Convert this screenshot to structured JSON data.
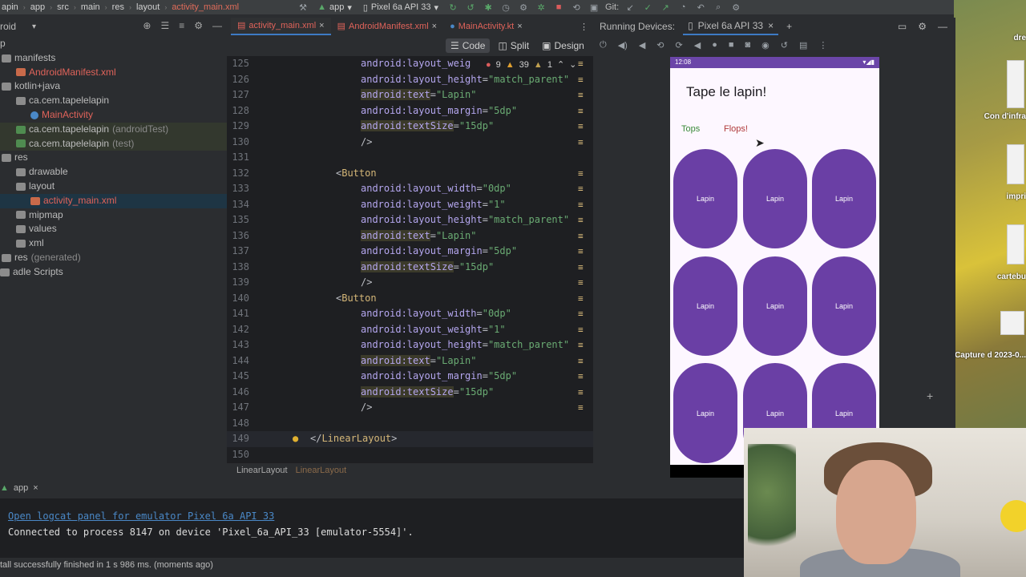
{
  "topbar": {
    "crumbs": [
      "apin",
      "app",
      "src",
      "main",
      "res",
      "layout"
    ],
    "file": "activity_main.xml",
    "run_config": "app",
    "device": "Pixel 6a API 33",
    "git_label": "Git:"
  },
  "project": {
    "header": "roid",
    "tree": [
      {
        "label": "p",
        "style": "plain"
      },
      {
        "label": "manifests",
        "style": "plain"
      },
      {
        "label": "AndroidManifest.xml",
        "style": "red"
      },
      {
        "label": "kotlin+java",
        "style": "plain"
      },
      {
        "label": "ca.cem.tapelelapin",
        "style": "plain"
      },
      {
        "label": "MainActivity",
        "style": "kt"
      },
      {
        "label": "ca.cem.tapelelapin",
        "suffix": "(androidTest)",
        "style": "test"
      },
      {
        "label": "ca.cem.tapelelapin",
        "suffix": "(test)",
        "style": "test"
      },
      {
        "label": "res",
        "style": "plain"
      },
      {
        "label": "drawable",
        "style": "plain"
      },
      {
        "label": "layout",
        "style": "plain"
      },
      {
        "label": "activity_main.xml",
        "style": "selected"
      },
      {
        "label": "mipmap",
        "style": "plain"
      },
      {
        "label": "values",
        "style": "plain"
      },
      {
        "label": "xml",
        "style": "plain"
      },
      {
        "label": "res",
        "suffix": "(generated)",
        "style": "plain"
      },
      {
        "label": "adle Scripts",
        "style": "plain"
      }
    ]
  },
  "editor": {
    "tabs": [
      "activity_main.xml",
      "AndroidManifest.xml",
      "MainActivity.kt"
    ],
    "view_modes": [
      "Code",
      "Split",
      "Design"
    ],
    "errors": "9",
    "warnings": "39",
    "weak_warnings": "1",
    "lines": [
      {
        "n": "125",
        "parts": [
          [
            "attr",
            "android:layout_weig"
          ]
        ]
      },
      {
        "n": "126",
        "parts": [
          [
            "attr",
            "android:layout_height"
          ],
          [
            "brk",
            "="
          ],
          [
            "str",
            "\"match_parent\""
          ]
        ]
      },
      {
        "n": "127",
        "parts": [
          [
            "attr-dim",
            "android:text"
          ],
          [
            "brk",
            "="
          ],
          [
            "str",
            "\"Lapin\""
          ]
        ]
      },
      {
        "n": "128",
        "parts": [
          [
            "attr",
            "android:layout_margin"
          ],
          [
            "brk",
            "="
          ],
          [
            "str",
            "\"5dp\""
          ]
        ]
      },
      {
        "n": "129",
        "parts": [
          [
            "attr-dim",
            "android:textSize"
          ],
          [
            "brk",
            "="
          ],
          [
            "str",
            "\"15dp\""
          ]
        ]
      },
      {
        "n": "130",
        "parts": [
          [
            "brk",
            "/>"
          ]
        ]
      },
      {
        "n": "131",
        "parts": []
      },
      {
        "n": "132",
        "parts": [
          [
            "brk",
            "<"
          ],
          [
            "tag",
            "Button"
          ]
        ],
        "indent": "tag"
      },
      {
        "n": "133",
        "parts": [
          [
            "attr",
            "android:layout_width"
          ],
          [
            "brk",
            "="
          ],
          [
            "str",
            "\"0dp\""
          ]
        ]
      },
      {
        "n": "134",
        "parts": [
          [
            "attr",
            "android:layout_weight"
          ],
          [
            "brk",
            "="
          ],
          [
            "str",
            "\"1\""
          ]
        ]
      },
      {
        "n": "135",
        "parts": [
          [
            "attr",
            "android:layout_height"
          ],
          [
            "brk",
            "="
          ],
          [
            "str",
            "\"match_parent\""
          ]
        ]
      },
      {
        "n": "136",
        "parts": [
          [
            "attr-dim",
            "android:text"
          ],
          [
            "brk",
            "="
          ],
          [
            "str",
            "\"Lapin\""
          ]
        ]
      },
      {
        "n": "137",
        "parts": [
          [
            "attr",
            "android:layout_margin"
          ],
          [
            "brk",
            "="
          ],
          [
            "str",
            "\"5dp\""
          ]
        ]
      },
      {
        "n": "138",
        "parts": [
          [
            "attr-dim",
            "android:textSize"
          ],
          [
            "brk",
            "="
          ],
          [
            "str",
            "\"15dp\""
          ]
        ]
      },
      {
        "n": "139",
        "parts": [
          [
            "brk",
            "/>"
          ]
        ]
      },
      {
        "n": "140",
        "parts": [
          [
            "brk",
            "<"
          ],
          [
            "tag",
            "Button"
          ]
        ],
        "indent": "tag"
      },
      {
        "n": "141",
        "parts": [
          [
            "attr",
            "android:layout_width"
          ],
          [
            "brk",
            "="
          ],
          [
            "str",
            "\"0dp\""
          ]
        ]
      },
      {
        "n": "142",
        "parts": [
          [
            "attr",
            "android:layout_weight"
          ],
          [
            "brk",
            "="
          ],
          [
            "str",
            "\"1\""
          ]
        ]
      },
      {
        "n": "143",
        "parts": [
          [
            "attr",
            "android:layout_height"
          ],
          [
            "brk",
            "="
          ],
          [
            "str",
            "\"match_parent\""
          ]
        ]
      },
      {
        "n": "144",
        "parts": [
          [
            "attr-dim",
            "android:text"
          ],
          [
            "brk",
            "="
          ],
          [
            "str",
            "\"Lapin\""
          ]
        ]
      },
      {
        "n": "145",
        "parts": [
          [
            "attr",
            "android:layout_margin"
          ],
          [
            "brk",
            "="
          ],
          [
            "str",
            "\"5dp\""
          ]
        ]
      },
      {
        "n": "146",
        "parts": [
          [
            "attr-dim",
            "android:textSize"
          ],
          [
            "brk",
            "="
          ],
          [
            "str",
            "\"15dp\""
          ]
        ]
      },
      {
        "n": "147",
        "parts": [
          [
            "brk",
            "/>"
          ]
        ]
      },
      {
        "n": "148",
        "parts": []
      },
      {
        "n": "149",
        "parts": [
          [
            "brk",
            "</"
          ],
          [
            "tag",
            "LinearLayout"
          ],
          [
            "brk",
            ">"
          ]
        ],
        "indent": "root"
      },
      {
        "n": "150",
        "parts": []
      }
    ],
    "bottom_breadcrumb": [
      "LinearLayout",
      "LinearLayout"
    ]
  },
  "running_devices": {
    "title": "Running Devices:",
    "device_tab": "Pixel 6a API 33"
  },
  "phone": {
    "time": "12:08",
    "app_title": "Tape le lapin!",
    "tops": "Tops",
    "flops": "Flops!",
    "button_label": "Lapin",
    "button_count": 9,
    "colors": {
      "button": "#6a3fa5",
      "status": "#6b46a8",
      "tops": "#3a8a3a",
      "flops": "#b03a3a"
    }
  },
  "run": {
    "tab": "app",
    "logcat_link": "Open logcat panel for emulator Pixel 6a API 33",
    "connected": "Connected to process 8147 on device 'Pixel_6a_API_33 [emulator-5554]'.",
    "status": "tall successfully finished in 1 s 986 ms. (moments ago)"
  },
  "desktop": {
    "labels": [
      "dre",
      "Con d'infra",
      "impri",
      "cartebu",
      "Capture d 2023-0..."
    ]
  }
}
